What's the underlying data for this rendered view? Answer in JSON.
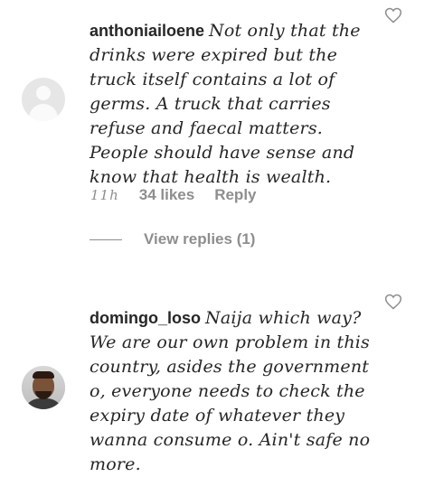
{
  "comments": [
    {
      "username": "anthoniailoene",
      "text": "Not only that the drinks were expired but the truck itself contains a lot of germs. A truck that carries refuse and faecal matters. People should have sense and know that health is wealth.",
      "time": "11h",
      "likes": "34 likes",
      "reply_label": "Reply",
      "view_replies": "View replies (1)",
      "avatar": "default-avatar-icon"
    },
    {
      "username": "domingo_loso",
      "text": "Naija which way? We are our own problem in this country, asides the government o, everyone needs to check the expiry date of whatever they wanna consume o. Ain't safe no more.",
      "avatar": "profile-photo"
    }
  ],
  "icons": {
    "like": "heart-outline-icon"
  },
  "colors": {
    "text": "#262626",
    "secondary": "#8e8e8e",
    "background": "#ffffff"
  }
}
